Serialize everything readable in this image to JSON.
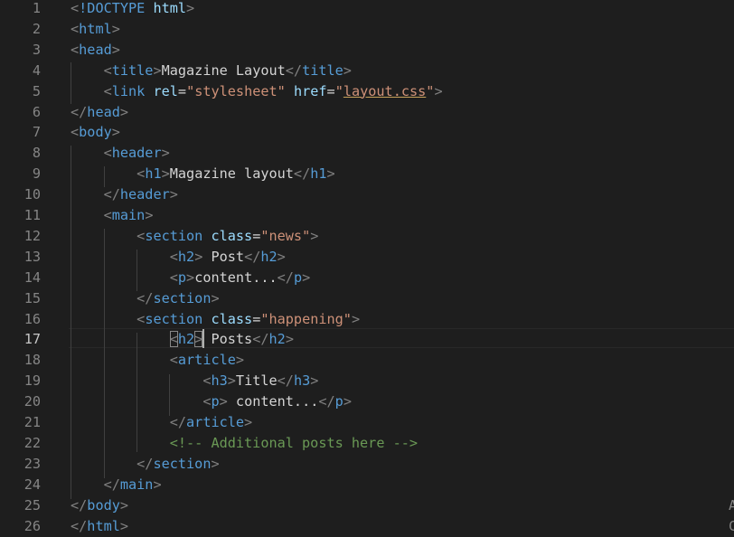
{
  "editor": {
    "language": "html",
    "current_line": 17,
    "line_numbers": [
      "1",
      "2",
      "3",
      "4",
      "5",
      "6",
      "7",
      "8",
      "9",
      "10",
      "11",
      "12",
      "13",
      "14",
      "15",
      "16",
      "17",
      "18",
      "19",
      "20",
      "21",
      "22",
      "23",
      "24",
      "25",
      "26"
    ],
    "overflow_glyphs": [
      "A",
      "C"
    ],
    "colors": {
      "background": "#1e1e1e",
      "line_number": "#858585",
      "tag": "#569cd6",
      "punctuation": "#808080",
      "attribute": "#9cdcfe",
      "string": "#ce9178",
      "comment": "#6a9955",
      "text": "#d4d4d4"
    },
    "lines": [
      [
        {
          "k": "p",
          "v": "<"
        },
        {
          "k": "t",
          "v": "!DOCTYPE"
        },
        {
          "k": "x",
          "v": " "
        },
        {
          "k": "a",
          "v": "html"
        },
        {
          "k": "p",
          "v": ">"
        }
      ],
      [
        {
          "k": "p",
          "v": "<"
        },
        {
          "k": "t",
          "v": "html"
        },
        {
          "k": "p",
          "v": ">"
        }
      ],
      [
        {
          "k": "p",
          "v": "<"
        },
        {
          "k": "t",
          "v": "head"
        },
        {
          "k": "p",
          "v": ">"
        }
      ],
      [
        {
          "k": "x",
          "v": "    "
        },
        {
          "k": "p",
          "v": "<"
        },
        {
          "k": "t",
          "v": "title"
        },
        {
          "k": "p",
          "v": ">"
        },
        {
          "k": "x",
          "v": "Magazine Layout"
        },
        {
          "k": "p",
          "v": "</"
        },
        {
          "k": "t",
          "v": "title"
        },
        {
          "k": "p",
          "v": ">"
        }
      ],
      [
        {
          "k": "x",
          "v": "    "
        },
        {
          "k": "p",
          "v": "<"
        },
        {
          "k": "t",
          "v": "link"
        },
        {
          "k": "x",
          "v": " "
        },
        {
          "k": "a",
          "v": "rel"
        },
        {
          "k": "x",
          "v": "="
        },
        {
          "k": "s",
          "v": "\"stylesheet\""
        },
        {
          "k": "x",
          "v": " "
        },
        {
          "k": "a",
          "v": "href"
        },
        {
          "k": "x",
          "v": "="
        },
        {
          "k": "s",
          "v": "\""
        },
        {
          "k": "u",
          "v": "layout.css"
        },
        {
          "k": "s",
          "v": "\""
        },
        {
          "k": "p",
          "v": ">"
        }
      ],
      [
        {
          "k": "p",
          "v": "</"
        },
        {
          "k": "t",
          "v": "head"
        },
        {
          "k": "p",
          "v": ">"
        }
      ],
      [
        {
          "k": "p",
          "v": "<"
        },
        {
          "k": "t",
          "v": "body"
        },
        {
          "k": "p",
          "v": ">"
        }
      ],
      [
        {
          "k": "x",
          "v": "    "
        },
        {
          "k": "p",
          "v": "<"
        },
        {
          "k": "t",
          "v": "header"
        },
        {
          "k": "p",
          "v": ">"
        }
      ],
      [
        {
          "k": "x",
          "v": "        "
        },
        {
          "k": "p",
          "v": "<"
        },
        {
          "k": "t",
          "v": "h1"
        },
        {
          "k": "p",
          "v": ">"
        },
        {
          "k": "x",
          "v": "Magazine layout"
        },
        {
          "k": "p",
          "v": "</"
        },
        {
          "k": "t",
          "v": "h1"
        },
        {
          "k": "p",
          "v": ">"
        }
      ],
      [
        {
          "k": "x",
          "v": "    "
        },
        {
          "k": "p",
          "v": "</"
        },
        {
          "k": "t",
          "v": "header"
        },
        {
          "k": "p",
          "v": ">"
        }
      ],
      [
        {
          "k": "x",
          "v": "    "
        },
        {
          "k": "p",
          "v": "<"
        },
        {
          "k": "t",
          "v": "main"
        },
        {
          "k": "p",
          "v": ">"
        }
      ],
      [
        {
          "k": "x",
          "v": "        "
        },
        {
          "k": "p",
          "v": "<"
        },
        {
          "k": "t",
          "v": "section"
        },
        {
          "k": "x",
          "v": " "
        },
        {
          "k": "a",
          "v": "class"
        },
        {
          "k": "x",
          "v": "="
        },
        {
          "k": "s",
          "v": "\"news\""
        },
        {
          "k": "p",
          "v": ">"
        }
      ],
      [
        {
          "k": "x",
          "v": "            "
        },
        {
          "k": "p",
          "v": "<"
        },
        {
          "k": "t",
          "v": "h2"
        },
        {
          "k": "p",
          "v": ">"
        },
        {
          "k": "x",
          "v": " Post"
        },
        {
          "k": "p",
          "v": "</"
        },
        {
          "k": "t",
          "v": "h2"
        },
        {
          "k": "p",
          "v": ">"
        }
      ],
      [
        {
          "k": "x",
          "v": "            "
        },
        {
          "k": "p",
          "v": "<"
        },
        {
          "k": "t",
          "v": "p"
        },
        {
          "k": "p",
          "v": ">"
        },
        {
          "k": "x",
          "v": "content..."
        },
        {
          "k": "p",
          "v": "</"
        },
        {
          "k": "t",
          "v": "p"
        },
        {
          "k": "p",
          "v": ">"
        }
      ],
      [
        {
          "k": "x",
          "v": "        "
        },
        {
          "k": "p",
          "v": "</"
        },
        {
          "k": "t",
          "v": "section"
        },
        {
          "k": "p",
          "v": ">"
        }
      ],
      [
        {
          "k": "x",
          "v": "        "
        },
        {
          "k": "p",
          "v": "<"
        },
        {
          "k": "t",
          "v": "section"
        },
        {
          "k": "x",
          "v": " "
        },
        {
          "k": "a",
          "v": "class"
        },
        {
          "k": "x",
          "v": "="
        },
        {
          "k": "s",
          "v": "\"happening\""
        },
        {
          "k": "p",
          "v": ">"
        }
      ],
      [
        {
          "k": "x",
          "v": "            "
        },
        {
          "k": "p",
          "v": "<",
          "b": 1
        },
        {
          "k": "t",
          "v": "h2"
        },
        {
          "k": "p",
          "v": ">",
          "b": 1
        },
        {
          "k": "x",
          "v": " Posts"
        },
        {
          "k": "p",
          "v": "</"
        },
        {
          "k": "t",
          "v": "h2"
        },
        {
          "k": "p",
          "v": ">"
        }
      ],
      [
        {
          "k": "x",
          "v": "            "
        },
        {
          "k": "p",
          "v": "<"
        },
        {
          "k": "t",
          "v": "article"
        },
        {
          "k": "p",
          "v": ">"
        }
      ],
      [
        {
          "k": "x",
          "v": "                "
        },
        {
          "k": "p",
          "v": "<"
        },
        {
          "k": "t",
          "v": "h3"
        },
        {
          "k": "p",
          "v": ">"
        },
        {
          "k": "x",
          "v": "Title"
        },
        {
          "k": "p",
          "v": "</"
        },
        {
          "k": "t",
          "v": "h3"
        },
        {
          "k": "p",
          "v": ">"
        }
      ],
      [
        {
          "k": "x",
          "v": "                "
        },
        {
          "k": "p",
          "v": "<"
        },
        {
          "k": "t",
          "v": "p"
        },
        {
          "k": "p",
          "v": ">"
        },
        {
          "k": "x",
          "v": " content..."
        },
        {
          "k": "p",
          "v": "</"
        },
        {
          "k": "t",
          "v": "p"
        },
        {
          "k": "p",
          "v": ">"
        }
      ],
      [
        {
          "k": "x",
          "v": "            "
        },
        {
          "k": "p",
          "v": "</"
        },
        {
          "k": "t",
          "v": "article"
        },
        {
          "k": "p",
          "v": ">"
        }
      ],
      [
        {
          "k": "x",
          "v": "            "
        },
        {
          "k": "c",
          "v": "<!-- Additional posts here -->"
        }
      ],
      [
        {
          "k": "x",
          "v": "        "
        },
        {
          "k": "p",
          "v": "</"
        },
        {
          "k": "t",
          "v": "section"
        },
        {
          "k": "p",
          "v": ">"
        }
      ],
      [
        {
          "k": "x",
          "v": "    "
        },
        {
          "k": "p",
          "v": "</"
        },
        {
          "k": "t",
          "v": "main"
        },
        {
          "k": "p",
          "v": ">"
        }
      ],
      [
        {
          "k": "p",
          "v": "</"
        },
        {
          "k": "t",
          "v": "body"
        },
        {
          "k": "p",
          "v": ">"
        }
      ],
      [
        {
          "k": "p",
          "v": "</"
        },
        {
          "k": "t",
          "v": "html"
        },
        {
          "k": "p",
          "v": ">"
        }
      ]
    ]
  }
}
